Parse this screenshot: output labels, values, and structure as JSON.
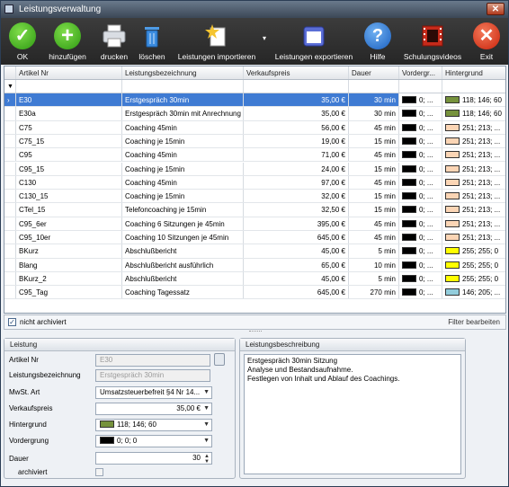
{
  "window": {
    "title": "Leistungsverwaltung",
    "close": "✕"
  },
  "toolbar": {
    "ok": "OK",
    "add": "hinzufügen",
    "print": "drucken",
    "delete": "löschen",
    "import": "Leistungen importieren",
    "export": "Leistungen exportieren",
    "help": "Hilfe",
    "videos": "Schulungsvideos",
    "exit": "Exit"
  },
  "grid": {
    "headers": [
      "Artikel Nr",
      "Leistungsbezeichnung",
      "Verkaufspreis",
      "Dauer",
      "Vordergr...",
      "Hintergrund"
    ],
    "rows": [
      {
        "nr": "E30",
        "name": "Erstgespräch 30min",
        "price": "35,00 €",
        "dur": "30 min",
        "fg": "0; ...",
        "fgc": "#000000",
        "bg": "118; 146; 60",
        "bgc": "#76923c",
        "selected": true
      },
      {
        "nr": "E30a",
        "name": "Erstgespräch 30min mit Anrechnung",
        "price": "35,00 €",
        "dur": "30 min",
        "fg": "0; ...",
        "fgc": "#000000",
        "bg": "118; 146; 60",
        "bgc": "#76923c"
      },
      {
        "nr": "C75",
        "name": "Coaching 45min",
        "price": "56,00 €",
        "dur": "45 min",
        "fg": "0; ...",
        "fgc": "#000000",
        "bg": "251; 213; ...",
        "bgc": "#fbd5b5"
      },
      {
        "nr": "C75_15",
        "name": "Coaching je 15min",
        "price": "19,00 €",
        "dur": "15 min",
        "fg": "0; ...",
        "fgc": "#000000",
        "bg": "251; 213; ...",
        "bgc": "#fbd5b5"
      },
      {
        "nr": "C95",
        "name": "Coaching 45min",
        "price": "71,00 €",
        "dur": "45 min",
        "fg": "0; ...",
        "fgc": "#000000",
        "bg": "251; 213; ...",
        "bgc": "#fbd5b5"
      },
      {
        "nr": "C95_15",
        "name": "Coaching je 15min",
        "price": "24,00 €",
        "dur": "15 min",
        "fg": "0; ...",
        "fgc": "#000000",
        "bg": "251; 213; ...",
        "bgc": "#fbd5b5"
      },
      {
        "nr": "C130",
        "name": "Coaching 45min",
        "price": "97,00 €",
        "dur": "45 min",
        "fg": "0; ...",
        "fgc": "#000000",
        "bg": "251; 213; ...",
        "bgc": "#fbd5b5"
      },
      {
        "nr": "C130_15",
        "name": "Coaching je 15min",
        "price": "32,00 €",
        "dur": "15 min",
        "fg": "0; ...",
        "fgc": "#000000",
        "bg": "251; 213; ...",
        "bgc": "#fbd5b5"
      },
      {
        "nr": "CTel_15",
        "name": "Telefoncoaching je 15min",
        "price": "32,50 €",
        "dur": "15 min",
        "fg": "0; ...",
        "fgc": "#000000",
        "bg": "251; 213; ...",
        "bgc": "#fbd5b5"
      },
      {
        "nr": "C95_6er",
        "name": "Coaching 6 Sitzungen je 45min",
        "price": "395,00 €",
        "dur": "45 min",
        "fg": "0; ...",
        "fgc": "#000000",
        "bg": "251; 213; ...",
        "bgc": "#fbd5b5"
      },
      {
        "nr": "C95_10er",
        "name": "Coaching 10 Sitzungen je 45min",
        "price": "645,00 €",
        "dur": "45 min",
        "fg": "0; ...",
        "fgc": "#000000",
        "bg": "251; 213; ...",
        "bgc": "#fbd5b5"
      },
      {
        "nr": "BKurz",
        "name": "Abschlußbericht",
        "price": "45,00 €",
        "dur": "5 min",
        "fg": "0; ...",
        "fgc": "#000000",
        "bg": "255; 255; 0",
        "bgc": "#ffff00"
      },
      {
        "nr": "Blang",
        "name": "Abschlußbericht ausführlich",
        "price": "65,00 €",
        "dur": "10 min",
        "fg": "0; ...",
        "fgc": "#000000",
        "bg": "255; 255; 0",
        "bgc": "#ffff00"
      },
      {
        "nr": "BKurz_2",
        "name": "Abschlußbericht",
        "price": "45,00 €",
        "dur": "5 min",
        "fg": "0; ...",
        "fgc": "#000000",
        "bg": "255; 255; 0",
        "bgc": "#ffff00"
      },
      {
        "nr": "C95_Tag",
        "name": "Coaching Tagessatz",
        "price": "645,00 €",
        "dur": "270 min",
        "fg": "0; ...",
        "fgc": "#000000",
        "bg": "146; 205; ...",
        "bgc": "#92cddc"
      }
    ]
  },
  "status": {
    "not_archived": "nicht archiviert",
    "edit_filter": "Filter bearbeiten"
  },
  "form": {
    "title": "Leistung",
    "artikel_label": "Artikel Nr",
    "artikel_value": "E30",
    "bez_label": "Leistungsbezeichnung",
    "bez_value": "Erstgespräch 30min",
    "mwst_label": "MwSt. Art",
    "mwst_value": "Umsatzsteuerbefreit §4 Nr 14...",
    "vk_label": "Verkaufspreis",
    "vk_value": "35,00 €",
    "hg_label": "Hintergrund",
    "hg_value": "118; 146; 60",
    "hg_color": "#76923c",
    "vg_label": "Vordergrung",
    "vg_value": "0; 0; 0",
    "vg_color": "#000000",
    "dauer_label": "Dauer",
    "dauer_value": "30",
    "archiv_label": "archiviert"
  },
  "description": {
    "title": "Leistungsbeschreibung",
    "text": "Erstgespräch 30min Sitzung\nAnalyse und Bestandsaufnahme.\nFestlegen von Inhalt und Ablauf des Coachings."
  }
}
